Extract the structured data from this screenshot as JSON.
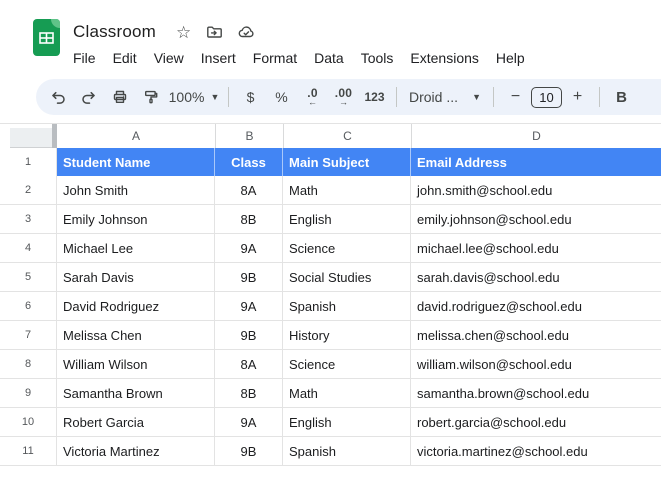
{
  "app": {
    "title": "Classroom",
    "menu": [
      "File",
      "Edit",
      "View",
      "Insert",
      "Format",
      "Data",
      "Tools",
      "Extensions",
      "Help"
    ],
    "title_icons": [
      "star-icon",
      "move-to-folder-icon",
      "cloud-saved-icon"
    ]
  },
  "toolbar": {
    "zoom_value": "100%",
    "currency_label": "$",
    "percent_label": "%",
    "decrease_decimal_label": ".0",
    "decrease_decimal_arrow": "←",
    "increase_decimal_label": ".00",
    "increase_decimal_arrow": "→",
    "number_format_label": "123",
    "font_family_value": "Droid ...",
    "decrease_font_label": "−",
    "font_size_value": "10",
    "increase_font_label": "+",
    "bold_label": "B"
  },
  "grid": {
    "column_letters": [
      "A",
      "B",
      "C",
      "D"
    ],
    "row_numbers": [
      "1",
      "2",
      "3",
      "4",
      "5",
      "6",
      "7",
      "8",
      "9",
      "10",
      "11"
    ],
    "header": {
      "cells": [
        "Student Name",
        "Class",
        "Main Subject",
        "Email Address"
      ]
    },
    "rows": [
      [
        "John Smith",
        "8A",
        "Math",
        "john.smith@school.edu"
      ],
      [
        "Emily Johnson",
        "8B",
        "English",
        "emily.johnson@school.edu"
      ],
      [
        "Michael Lee",
        "9A",
        "Science",
        "michael.lee@school.edu"
      ],
      [
        "Sarah Davis",
        "9B",
        "Social Studies",
        "sarah.davis@school.edu"
      ],
      [
        "David Rodriguez",
        "9A",
        "Spanish",
        "david.rodriguez@school.edu"
      ],
      [
        "Melissa Chen",
        "9B",
        "History",
        "melissa.chen@school.edu"
      ],
      [
        "William Wilson",
        "8A",
        "Science",
        "william.wilson@school.edu"
      ],
      [
        "Samantha Brown",
        "8B",
        "Math",
        "samantha.brown@school.edu"
      ],
      [
        "Robert Garcia",
        "9A",
        "English",
        "robert.garcia@school.edu"
      ],
      [
        "Victoria Martinez",
        "9B",
        "Spanish",
        "victoria.martinez@school.edu"
      ]
    ]
  },
  "colors": {
    "header_row_bg": "#4285f4",
    "header_row_text": "#ffffff",
    "toolbar_bg": "#edf2fa",
    "grid_line": "#e3e3e3",
    "sheets_green": "#169c53"
  }
}
